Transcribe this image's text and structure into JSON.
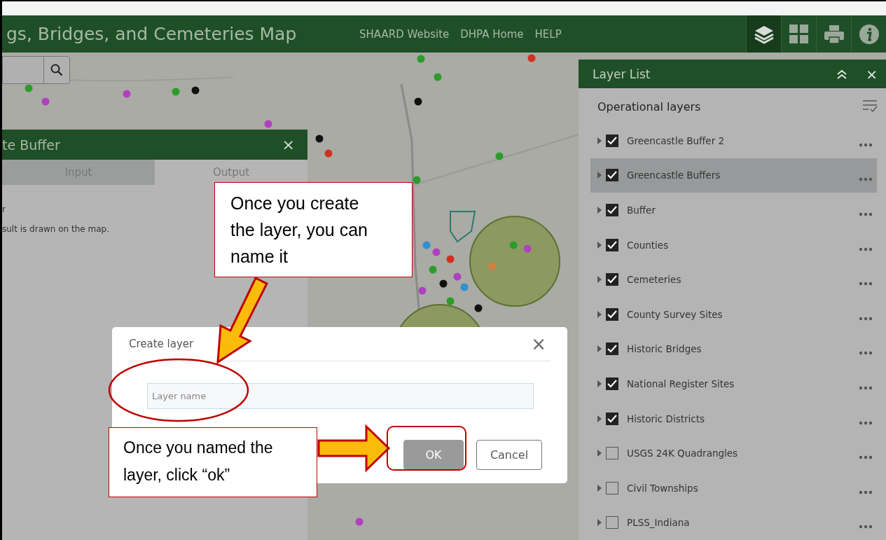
{
  "header": {
    "title": "gs, Bridges, and Cemeteries Map",
    "links": [
      "SHAARD Website",
      "DHPA Home",
      "HELP"
    ],
    "tools": [
      {
        "kind": "layers",
        "selected": true
      },
      {
        "kind": "grid",
        "selected": false
      },
      {
        "kind": "print",
        "selected": false
      },
      {
        "kind": "info",
        "selected": false
      }
    ]
  },
  "buffer_panel": {
    "title": "te Buffer",
    "close": "×",
    "tabs": [
      {
        "label": "Input",
        "selected": false
      },
      {
        "label": "Output",
        "selected": true
      }
    ],
    "lines": [
      "r",
      "sult is drawn on the map."
    ]
  },
  "layer_list": {
    "title": "Layer List",
    "close": "×",
    "section": "Operational layers",
    "layers": [
      {
        "name": "Greencastle Buffer 2",
        "checked": true,
        "selected": false
      },
      {
        "name": "Greencastle Buffers",
        "checked": true,
        "selected": true
      },
      {
        "name": "Buffer",
        "checked": true,
        "selected": false
      },
      {
        "name": "Counties",
        "checked": true,
        "selected": false
      },
      {
        "name": "Cemeteries",
        "checked": true,
        "selected": false
      },
      {
        "name": "County Survey Sites",
        "checked": true,
        "selected": false
      },
      {
        "name": "Historic Bridges",
        "checked": true,
        "selected": false
      },
      {
        "name": "National Register Sites",
        "checked": true,
        "selected": false
      },
      {
        "name": "Historic Districts",
        "checked": true,
        "selected": false
      },
      {
        "name": "USGS 24K Quadrangles",
        "checked": false,
        "selected": false
      },
      {
        "name": "Civil Townships",
        "checked": false,
        "selected": false
      },
      {
        "name": "PLSS_Indiana",
        "checked": false,
        "selected": false
      }
    ]
  },
  "dialog": {
    "title": "Create layer",
    "close": "×",
    "placeholder": "Layer name",
    "buttons": [
      {
        "label": "OK",
        "disabled": true
      },
      {
        "label": "Cancel",
        "disabled": false
      }
    ]
  },
  "callouts": [
    "Once you create the layer, you can name it",
    "Once you named the layer, click “ok”"
  ]
}
